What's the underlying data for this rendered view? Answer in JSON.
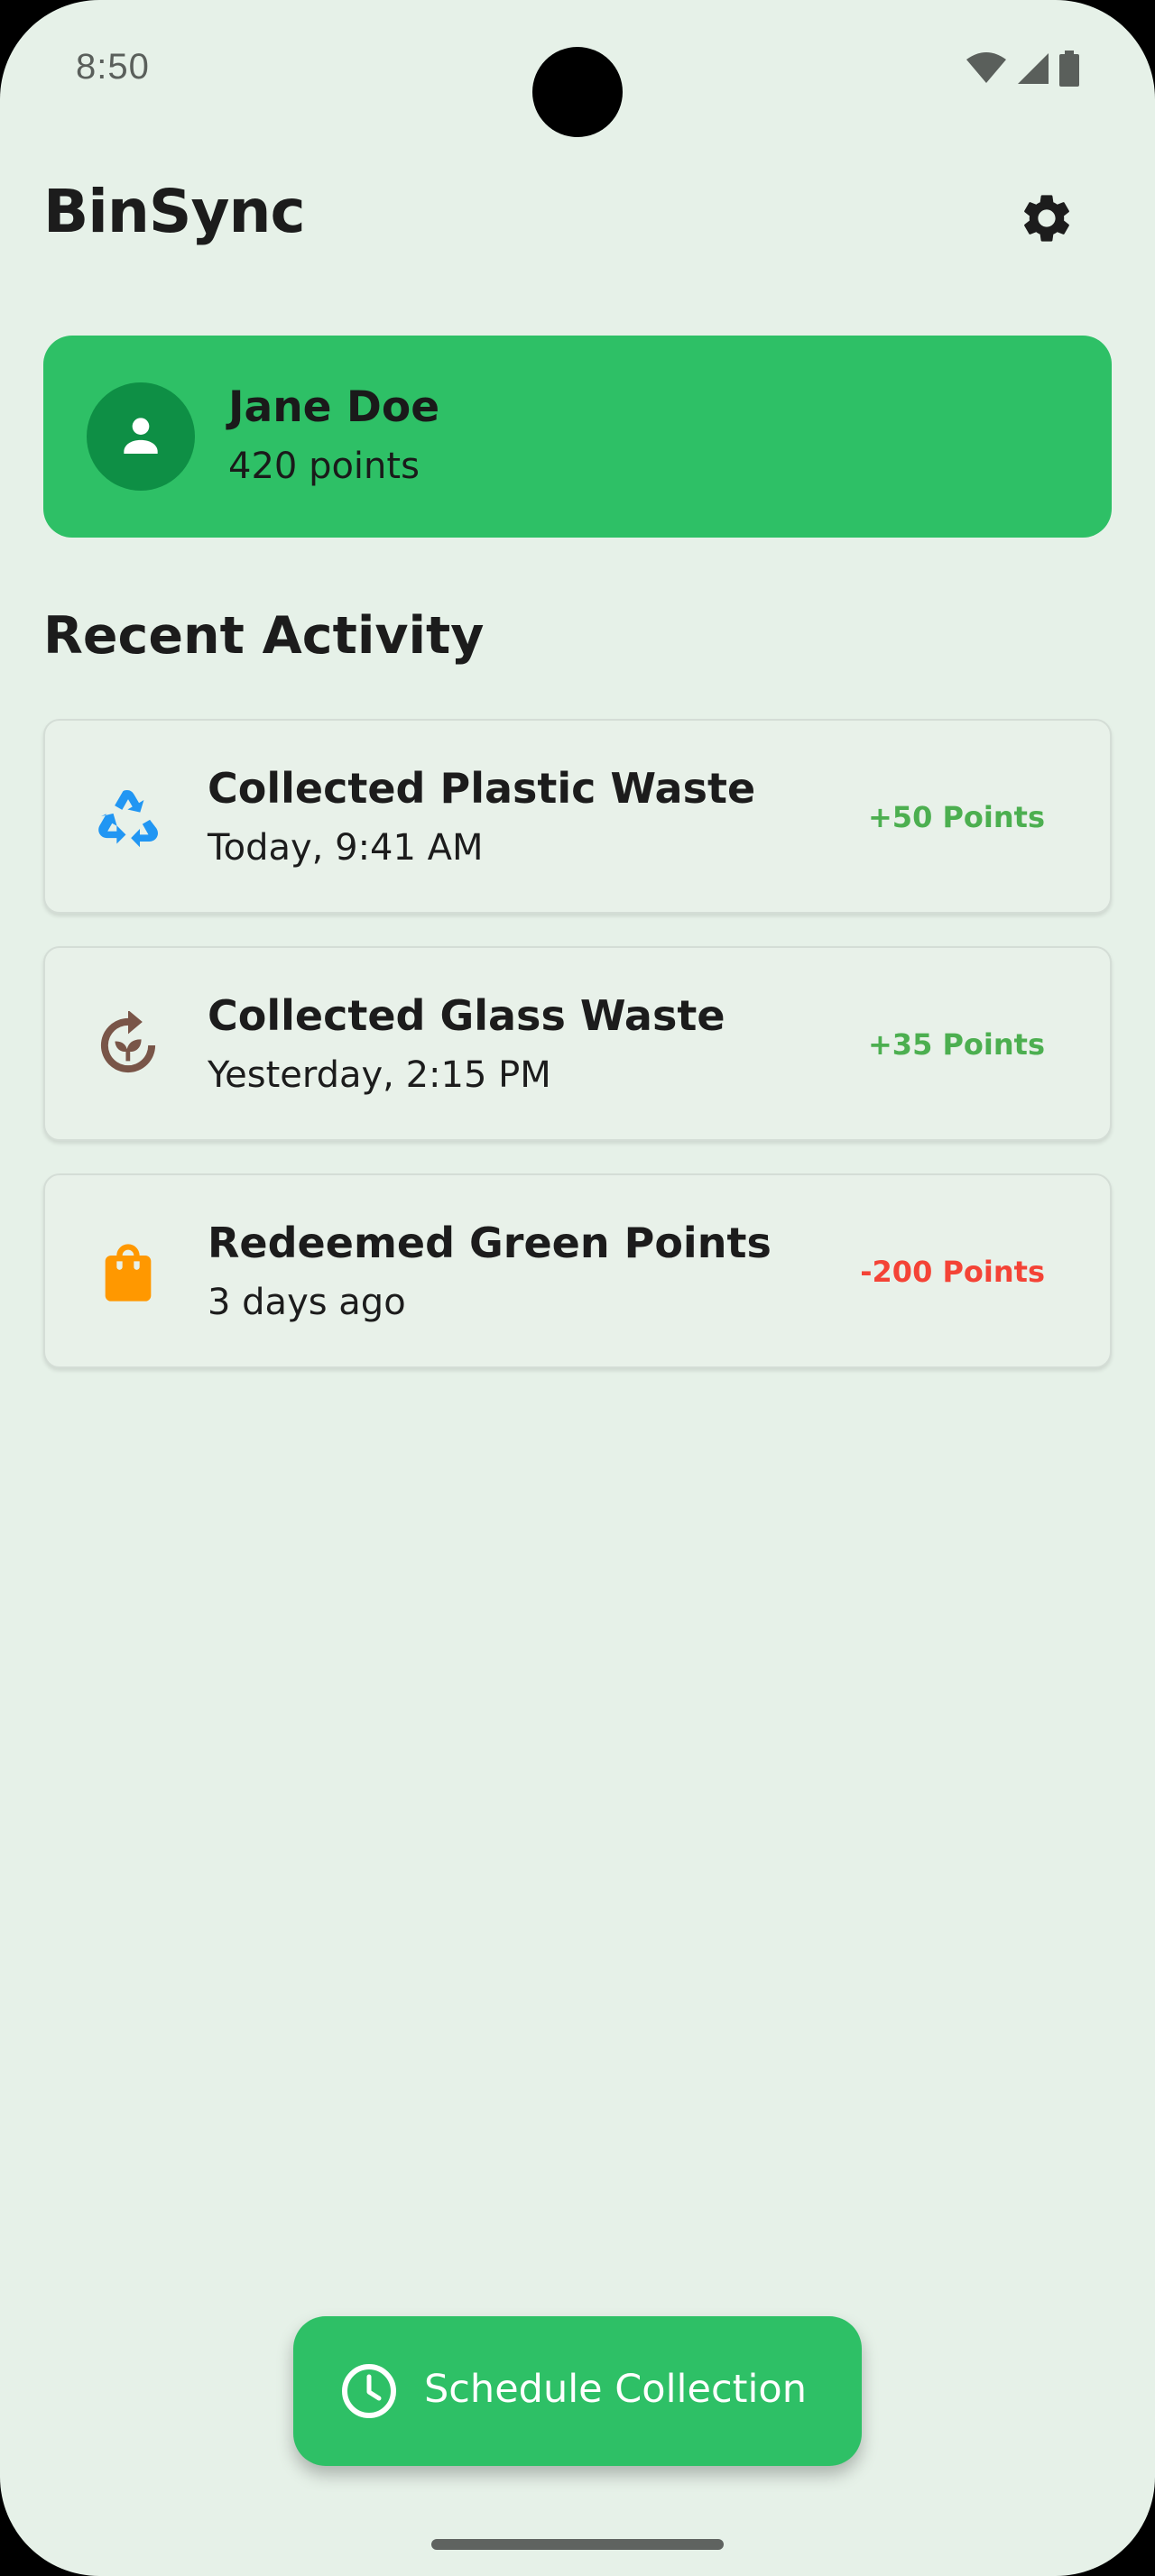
{
  "status_bar": {
    "time": "8:50",
    "icons": [
      "wifi-icon",
      "signal-icon",
      "battery-icon"
    ]
  },
  "app_bar": {
    "title": "BinSync",
    "settings_icon": "gear-icon"
  },
  "profile": {
    "name": "Jane Doe",
    "points": "420 points",
    "avatar_icon": "person-icon"
  },
  "recent_activity": {
    "heading": "Recent Activity",
    "items": [
      {
        "title": "Collected Plastic Waste",
        "subtitle": "Today, 9:41 AM",
        "points": "+50 Points",
        "icon": "recycle-icon",
        "icon_color": "#2196f3",
        "points_color": "#4caf50"
      },
      {
        "title": "Collected Glass Waste",
        "subtitle": "Yesterday, 2:15 PM",
        "points": "+35 Points",
        "icon": "compost-icon",
        "icon_color": "#795548",
        "points_color": "#4caf50"
      },
      {
        "title": "Redeemed Green Points",
        "subtitle": "3 days ago",
        "points": "-200 Points",
        "icon": "shopping-bag-icon",
        "icon_color": "#ff9800",
        "points_color": "#f44336"
      }
    ]
  },
  "schedule_button": {
    "label": "Schedule Collection",
    "icon": "clock-icon"
  },
  "colors": {
    "background": "#e6f1e8",
    "primary": "#2ec066",
    "avatar_bg": "#0e8f45",
    "positive": "#4caf50",
    "negative": "#f44336"
  }
}
